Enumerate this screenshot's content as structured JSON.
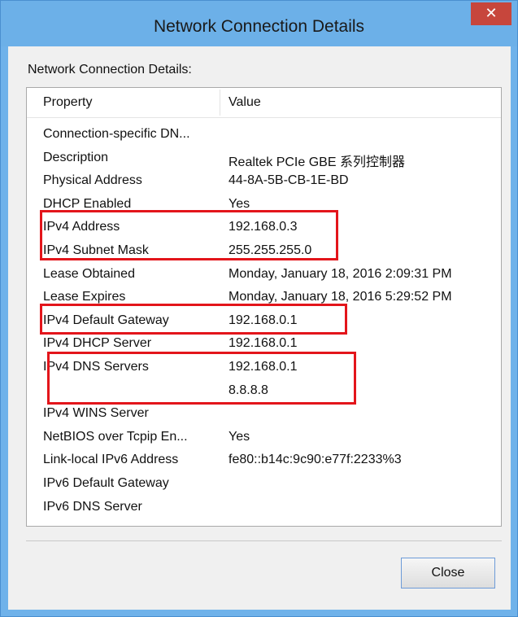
{
  "window": {
    "title": "Network Connection Details",
    "close_glyph": "✕"
  },
  "group_label": "Network Connection Details:",
  "columns": {
    "property": "Property",
    "value": "Value"
  },
  "rows": [
    {
      "property": "Connection-specific DN...",
      "value": [
        ""
      ]
    },
    {
      "property": "Description",
      "value": [
        "Realtek PCIe GBE 系列控制器"
      ]
    },
    {
      "property": "Physical Address",
      "value": [
        "44-8A-5B-CB-1E-BD"
      ]
    },
    {
      "property": "DHCP Enabled",
      "value": [
        "Yes"
      ]
    },
    {
      "property": "IPv4 Address",
      "value": [
        "192.168.0.3"
      ]
    },
    {
      "property": "IPv4 Subnet Mask",
      "value": [
        "255.255.255.0"
      ]
    },
    {
      "property": "Lease Obtained",
      "value": [
        "Monday, January 18, 2016 2:09:31 PM"
      ]
    },
    {
      "property": "Lease Expires",
      "value": [
        "Monday, January 18, 2016 5:29:52 PM"
      ]
    },
    {
      "property": "IPv4 Default Gateway",
      "value": [
        "192.168.0.1"
      ]
    },
    {
      "property": "IPv4 DHCP Server",
      "value": [
        "192.168.0.1"
      ]
    },
    {
      "property": "IPv4 DNS Servers",
      "value": [
        "192.168.0.1",
        "8.8.8.8"
      ]
    },
    {
      "property": "IPv4 WINS Server",
      "value": [
        ""
      ]
    },
    {
      "property": "NetBIOS over Tcpip En...",
      "value": [
        "Yes"
      ]
    },
    {
      "property": "Link-local IPv6 Address",
      "value": [
        "fe80::b14c:9c90:e77f:2233%3"
      ]
    },
    {
      "property": "IPv6 Default Gateway",
      "value": [
        ""
      ]
    },
    {
      "property": "IPv6 DNS Server",
      "value": [
        ""
      ]
    }
  ],
  "highlight_color": "#e3151b",
  "buttons": {
    "close_label": "Close"
  }
}
